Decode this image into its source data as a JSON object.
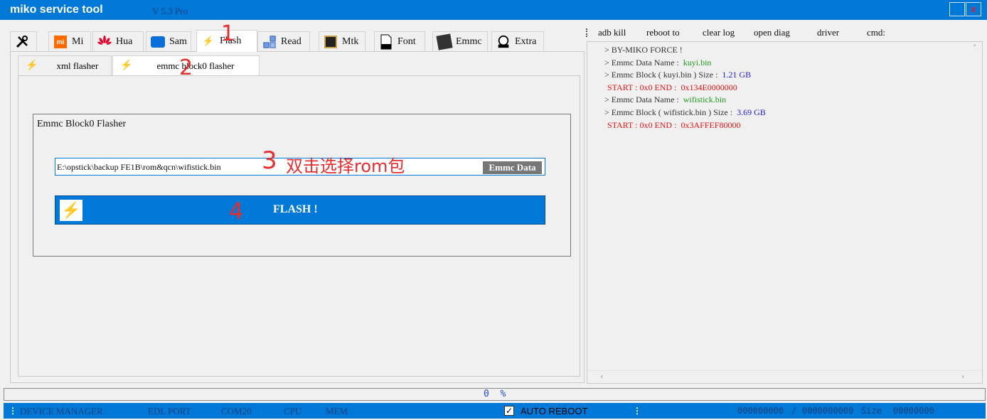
{
  "window": {
    "title": "miko service tool",
    "version": "V 5.3 Pro",
    "close_glyph": "x"
  },
  "tabs": [
    {
      "label": "Mi",
      "icon": "xiaomi-logo-icon"
    },
    {
      "label": "Hua",
      "icon": "huawei-logo-icon"
    },
    {
      "label": "Sam",
      "icon": "samsung-logo-icon"
    },
    {
      "label": "Flash",
      "icon": "lightning-icon",
      "active": true
    },
    {
      "label": "Read",
      "icon": "database-icon"
    },
    {
      "label": "Mtk",
      "icon": "chip-icon"
    },
    {
      "label": "Font",
      "icon": "font-file-icon"
    },
    {
      "label": "Emmc",
      "icon": "emmc-chip-icon"
    },
    {
      "label": "Extra",
      "icon": "extra-icon"
    }
  ],
  "subtabs": [
    {
      "label": "xml flasher",
      "icon": "lightning-icon"
    },
    {
      "label": "emmc block0 flasher",
      "icon": "lightning-icon",
      "active": true
    }
  ],
  "flasher": {
    "group_title": "Emmc Block0 Flasher",
    "rom_path": "E:\\opstick\\backup FE1B\\rom&qcn\\wifistick.bin",
    "emmc_data_label": "Emmc Data",
    "flash_label": "FLASH !"
  },
  "annotations": {
    "n1": "1",
    "n2": "2",
    "n3": "3",
    "n3_text": "双击选择rom包",
    "n4": "4"
  },
  "toolbar": {
    "adb_kill": "adb kill",
    "reboot_to": "reboot to",
    "clear_log": "clear log",
    "open_diag": "open diag",
    "driver": "driver",
    "cmd": "cmd:"
  },
  "log": [
    {
      "prefix": "> BY-MIKO FORCE !",
      "value": ""
    },
    {
      "prefix": "> Emmc Data Name  :",
      "value": "kuyi.bin"
    },
    {
      "prefix": "> Emmc Block ( kuyi.bin ) Size   :",
      "value": "1.21 GB"
    },
    {
      "prefix": "START  :  0x0    END :",
      "value": "0x134E0000000"
    },
    {
      "prefix": "> Emmc Data Name  :",
      "value": "wifistick.bin"
    },
    {
      "prefix": "> Emmc Block ( wifistick.bin ) Size   :",
      "value": "3.69 GB"
    },
    {
      "prefix": "START  :  0x0    END :",
      "value": "0x3AFFEF80000"
    }
  ],
  "progress": {
    "value": "0",
    "unit": "%"
  },
  "status": {
    "device_manager": "DEVICE MANAGER",
    "edl_port": "EDL PORT",
    "com": "COM20",
    "cpu": "CPU",
    "mem": "MEM",
    "auto_reboot": "AUTO REBOOT",
    "check": "✓",
    "counter1": "000000000",
    "sep": "/",
    "counter2": "0000000000",
    "size_label": "Size",
    "counter3": "00000000"
  },
  "colors": {
    "accent": "#0078d7",
    "annotation": "#e62e2e",
    "log_green": "#1e9a1e",
    "log_blue": "#1e1ee0",
    "log_red": "#e81414"
  }
}
